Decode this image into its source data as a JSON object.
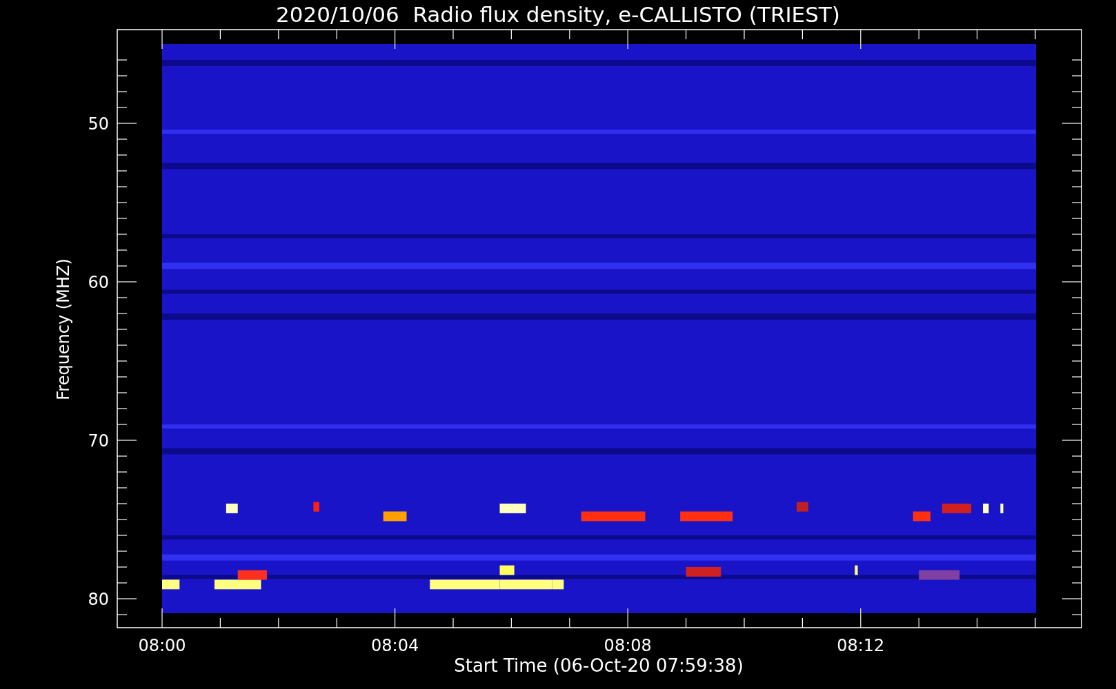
{
  "title": "2020/10/06  Radio flux density, e-CALLISTO (TRIEST)",
  "y_axis": {
    "label": "Frequency (MHZ)",
    "ticks": [
      "50",
      "60",
      "70",
      "80"
    ]
  },
  "x_axis": {
    "label": "Start Time (06-Oct-20 07:59:38)",
    "ticks": [
      "08:00",
      "08:04",
      "08:08",
      "08:12"
    ]
  }
}
